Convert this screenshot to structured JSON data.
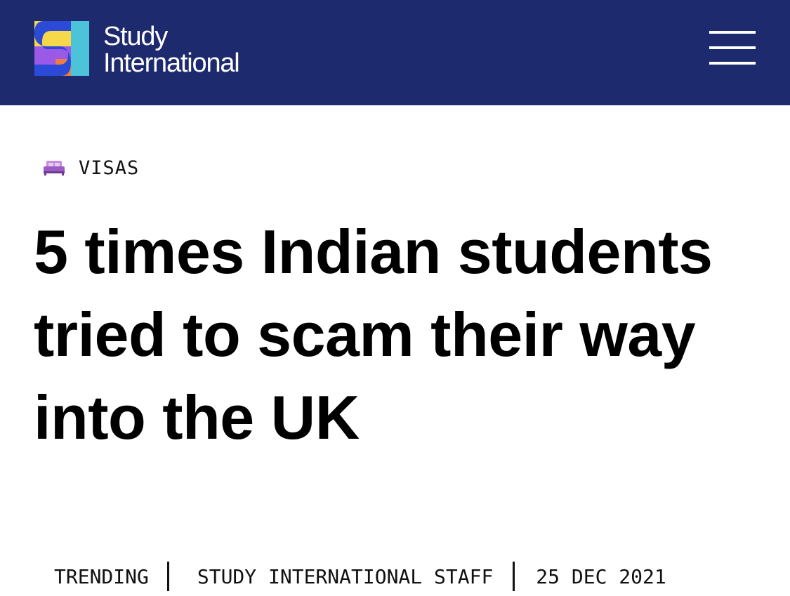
{
  "header": {
    "brand_line1": "Study",
    "brand_line2": "International",
    "logo_icon": "study-international-logo",
    "menu_icon": "hamburger-menu-icon",
    "background_color": "#1e2a6e"
  },
  "article": {
    "category": {
      "icon": "bed-icon",
      "label": "VISAS"
    },
    "headline_lines": [
      "5 times Indian students",
      "tried to scam their way",
      "into the UK"
    ],
    "meta": {
      "section": "TRENDING",
      "author": "STUDY INTERNATIONAL STAFF",
      "date": "25 DEC 2021"
    }
  }
}
